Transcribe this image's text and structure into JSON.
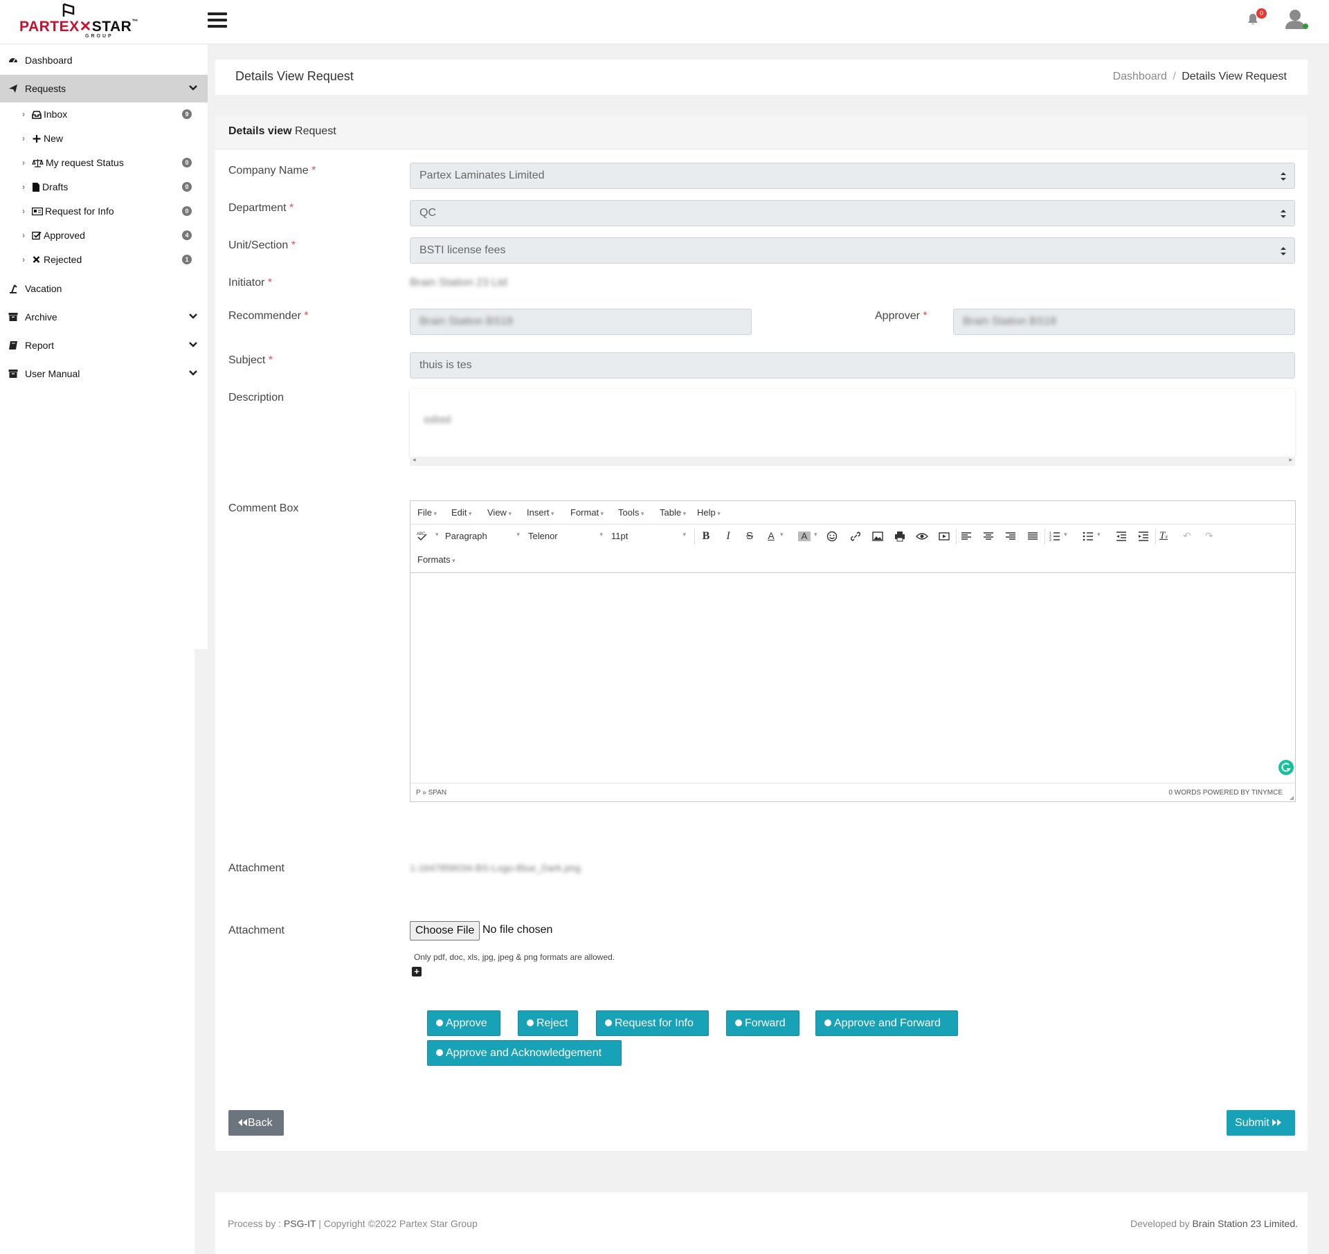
{
  "brand": {
    "logo_left": "PARTEX",
    "logo_right": "STAR",
    "logo_sub": "GROUP",
    "logo_tm": "™"
  },
  "topbar": {
    "notification_count": "0"
  },
  "sidebar": {
    "items": [
      {
        "label": "Dashboard",
        "icon": "dashboard-icon"
      },
      {
        "label": "Requests",
        "icon": "paper-plane-icon"
      },
      {
        "label": "Vacation",
        "icon": "vacation-icon"
      },
      {
        "label": "Archive",
        "icon": "archive-icon"
      },
      {
        "label": "Report",
        "icon": "book-icon"
      },
      {
        "label": "User Manual",
        "icon": "archive-icon"
      }
    ],
    "subitems": [
      {
        "label": "Inbox",
        "badge": "9",
        "icon": "inbox-icon"
      },
      {
        "label": "New",
        "badge": "",
        "icon": "plus-icon"
      },
      {
        "label": "My request Status",
        "badge": "0",
        "icon": "balance-icon"
      },
      {
        "label": "Drafts",
        "badge": "0",
        "icon": "file-icon"
      },
      {
        "label": "Request for Info",
        "badge": "0",
        "icon": "id-card-icon"
      },
      {
        "label": "Approved",
        "badge": "4",
        "icon": "check-square-icon"
      },
      {
        "label": "Rejected",
        "badge": "1",
        "icon": "times-icon"
      }
    ]
  },
  "header": {
    "title": "Details View Request",
    "breadcrumb_home": "Dashboard",
    "breadcrumb_sep": "/",
    "breadcrumb_current": "Details View Request"
  },
  "form": {
    "card_title_bold": "Details view",
    "card_title_rest": " Request",
    "required_mark": "*",
    "company_label": "Company Name",
    "company_value": "Partex Laminates Limited",
    "department_label": "Department",
    "department_value": "QC",
    "unit_label": "Unit/Section",
    "unit_value": "BSTI license fees",
    "initiator_label": "Initiator",
    "initiator_value": "Brain Station 23 Ltd",
    "recommender_label": "Recommender",
    "recommender_value": "Brain Station BS18",
    "approver_label": "Approver",
    "approver_value": "Brain Station BS18",
    "subject_label": "Subject",
    "subject_value": "thuis is tes",
    "description_label": "Description",
    "description_value": "ssbsd",
    "comment_label": "Comment Box",
    "attachment_label": "Attachment",
    "attachment_file": "1-1647856034-BS-Logo-Blue_Dark.png",
    "attachment2_label": "Attachment",
    "choose_file": "Choose File",
    "no_file": "No file chosen",
    "file_hint": "Only pdf, doc, xls, jpg, jpeg & png formats are allowed."
  },
  "editor": {
    "menus": [
      "File",
      "Edit",
      "View",
      "Insert",
      "Format",
      "Tools",
      "Table",
      "Help"
    ],
    "block_format": "Paragraph",
    "font_family": "Telenor",
    "font_size": "11pt",
    "formats": "Formats",
    "status_path": "P » SPAN",
    "status_right": "0 WORDS POWERED BY TINYMCE"
  },
  "actions": [
    "Approve",
    "Reject",
    "Request for Info",
    "Forward",
    "Approve and Forward",
    "Approve and Acknowledgement"
  ],
  "back_label": "Back",
  "submit_label": "Submit",
  "footer": {
    "left_prefix": "Process by : ",
    "left_org": "PSG-IT",
    "left_rest": " | Copyright ©2022 ",
    "left_company": "Partex Star Group",
    "right_prefix": "Developed by ",
    "right_company": "Brain Station 23 Limited."
  },
  "colors": {
    "accent": "#17a2b8",
    "back": "#6c757d",
    "required": "#d9534f",
    "brand_red": "#c8102e"
  }
}
